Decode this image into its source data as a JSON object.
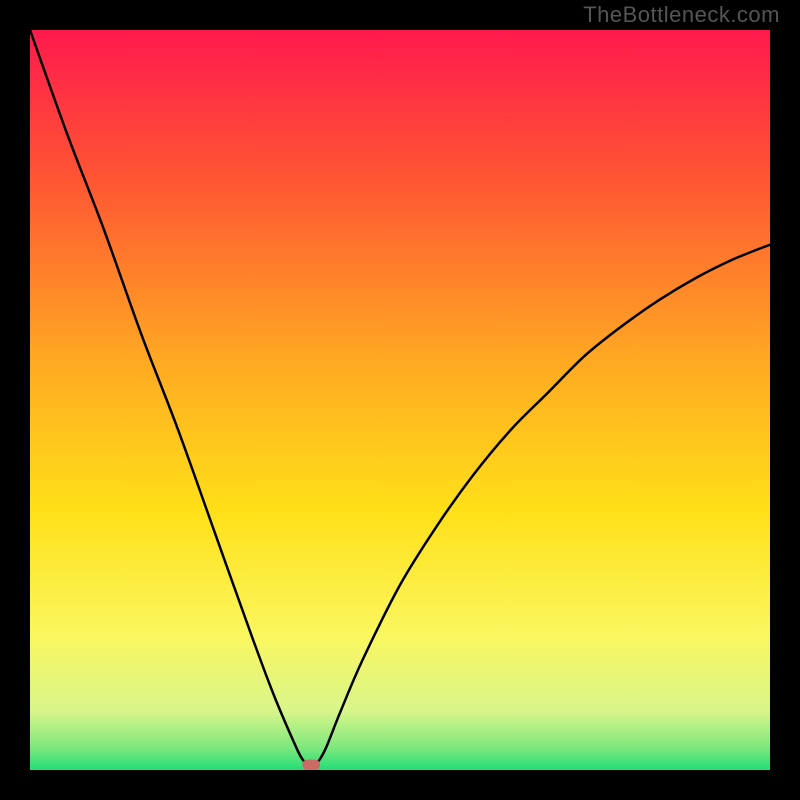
{
  "watermark": "TheBottleneck.com",
  "colors": {
    "gradient": [
      {
        "offset": 0,
        "hex": "#ff1a4d"
      },
      {
        "offset": 20,
        "hex": "#ff5533"
      },
      {
        "offset": 45,
        "hex": "#ffaa22"
      },
      {
        "offset": 65,
        "hex": "#ffe018"
      },
      {
        "offset": 82,
        "hex": "#faf760"
      },
      {
        "offset": 92,
        "hex": "#d8f58a"
      },
      {
        "offset": 97,
        "hex": "#7de87d"
      },
      {
        "offset": 100,
        "hex": "#22dd77"
      }
    ],
    "curve": "#000000",
    "marker": "#cc6b66",
    "frame": "#000000"
  },
  "chart_data": {
    "type": "line",
    "title": "",
    "xlabel": "",
    "ylabel": "",
    "xlim": [
      0,
      100
    ],
    "ylim": [
      0,
      100
    ],
    "optimum_x": 38,
    "marker": {
      "x": 38,
      "y": 0,
      "w": 2.4,
      "h": 1.4
    },
    "series": [
      {
        "name": "bottleneck-curve",
        "x": [
          0,
          5,
          10,
          15,
          20,
          25,
          30,
          33,
          36,
          37,
          38,
          39,
          40,
          42,
          45,
          50,
          55,
          60,
          65,
          70,
          75,
          80,
          85,
          90,
          95,
          100
        ],
        "y": [
          100,
          86,
          73,
          59,
          46,
          32,
          18,
          10,
          3,
          1.2,
          0,
          1.2,
          3,
          8,
          15,
          25,
          33,
          40,
          46,
          51,
          56,
          60,
          63.5,
          66.5,
          69,
          71
        ]
      }
    ]
  }
}
